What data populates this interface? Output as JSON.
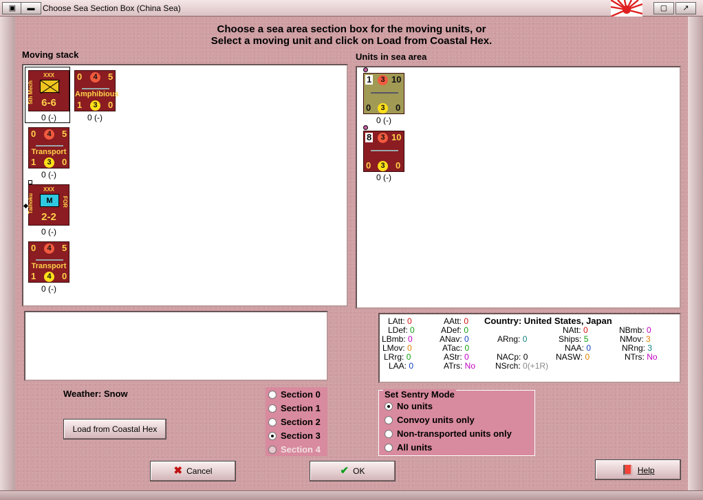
{
  "window": {
    "title": "Choose Sea Section Box (China Sea)"
  },
  "header": {
    "line1": "Choose a sea area section box for the moving units, or",
    "line2": "Select a moving unit and click on Load from Coastal Hex."
  },
  "moving_stack": {
    "label": "Moving stack",
    "units": [
      {
        "name": "5th Mech",
        "type": "mech",
        "value": "6-6",
        "size": "XXX",
        "under": "0 (-)"
      },
      {
        "name": "Amphibious",
        "type": "naval",
        "nums": [
          "0",
          "4",
          "5",
          "1",
          "3",
          "0"
        ],
        "under": "0 (-)"
      },
      {
        "name": "Transport",
        "type": "naval",
        "nums": [
          "0",
          "4",
          "5",
          "1",
          "3",
          "0"
        ],
        "under": "0 (-)"
      },
      {
        "name": "Taihoku",
        "type": "garrison",
        "value": "2-2",
        "size": "XXX",
        "side": "FOR",
        "badge": "M",
        "under": "0 (-)"
      },
      {
        "name": "Transport",
        "type": "naval",
        "nums": [
          "0",
          "4",
          "5",
          "1",
          "4",
          "0"
        ],
        "under": "0 (-)"
      }
    ]
  },
  "sea_area": {
    "label": "Units in sea area",
    "units": [
      {
        "nums": [
          "1",
          "3",
          "10",
          "0",
          "3",
          "0"
        ],
        "under": "0 (-)"
      },
      {
        "nums": [
          "8",
          "3",
          "10",
          "0",
          "3",
          "0"
        ],
        "under": "0 (-)"
      }
    ]
  },
  "stats": {
    "country_label": "Country: United States, Japan",
    "LAtt": "0",
    "LDef": "0",
    "LBmb": "0",
    "LMov": "0",
    "LRrg": "0",
    "LAA": "0",
    "AAtt": "0",
    "ADef": "0",
    "ANav": "0",
    "ATac": "0",
    "AStr": "0",
    "ATrs": "No",
    "ARng": "0",
    "NACp": "0",
    "NSrch": "0(+1R)",
    "NAtt": "0",
    "Ships": "5",
    "NAA": "0",
    "NASW": "0",
    "NBmb": "0",
    "NMov": "3",
    "NRng": "3",
    "NTrs": "No"
  },
  "weather": "Weather: Snow",
  "sections": [
    "Section 0",
    "Section 1",
    "Section 2",
    "Section 3",
    "Section 4"
  ],
  "selected_section": 3,
  "sentry": {
    "legend": "Set Sentry Mode",
    "options": [
      "No units",
      "Convoy units only",
      "Non-transported units only",
      "All units"
    ],
    "selected": 0
  },
  "buttons": {
    "load": "Load from Coastal Hex",
    "cancel": "Cancel",
    "ok": "OK",
    "help": "Help"
  },
  "colors": {
    "counter_red": "#8a1c22",
    "counter_olive": "#a19a55",
    "panel_pink": "#d88a9e"
  }
}
